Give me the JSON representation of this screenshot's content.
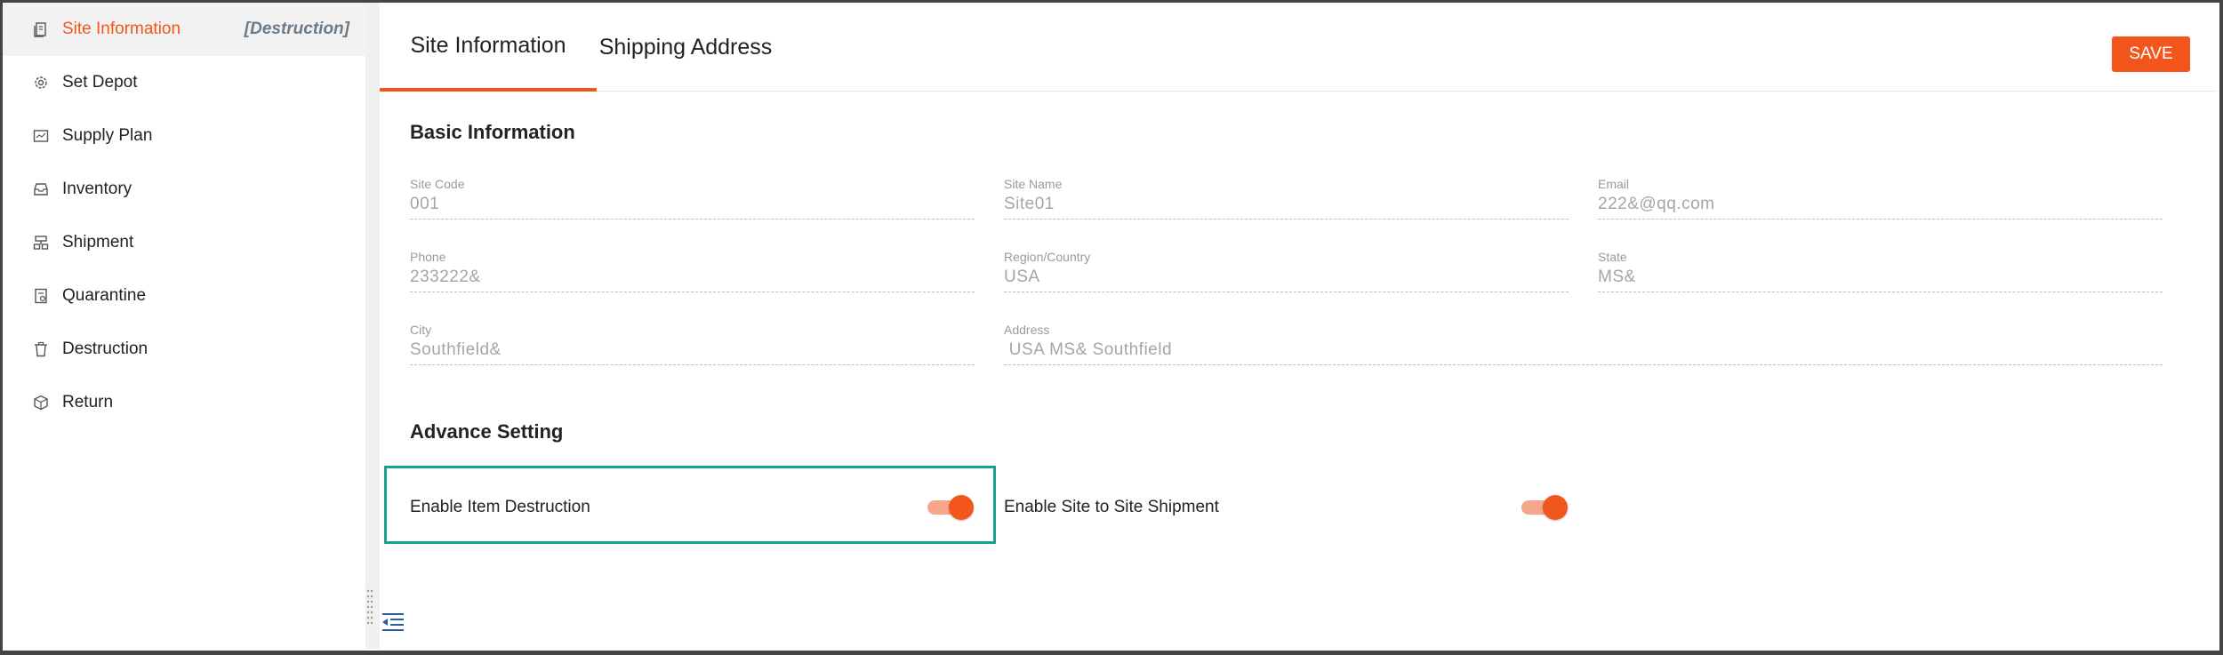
{
  "sidebar": {
    "items": [
      {
        "label": "Site Information",
        "tag": "[Destruction]",
        "icon": "document-icon",
        "active": true
      },
      {
        "label": "Set Depot",
        "icon": "gear-icon"
      },
      {
        "label": "Supply Plan",
        "icon": "calendar-icon"
      },
      {
        "label": "Inventory",
        "icon": "inbox-icon"
      },
      {
        "label": "Shipment",
        "icon": "shipment-icon"
      },
      {
        "label": "Quarantine",
        "icon": "quarantine-icon"
      },
      {
        "label": "Destruction",
        "icon": "trash-icon"
      },
      {
        "label": "Return",
        "icon": "box-icon"
      }
    ]
  },
  "tabs": [
    {
      "label": "Site Information",
      "active": true
    },
    {
      "label": "Shipping Address",
      "active": false
    }
  ],
  "toolbar": {
    "save_label": "SAVE"
  },
  "basic": {
    "title": "Basic Information",
    "fields": [
      {
        "label": "Site Code",
        "value": "001"
      },
      {
        "label": "Site Name",
        "value": "Site01"
      },
      {
        "label": "Email",
        "value": "222&@qq.com"
      },
      {
        "label": "Phone",
        "value": "233222&"
      },
      {
        "label": "Region/Country",
        "value": "USA"
      },
      {
        "label": "State",
        "value": "MS&"
      },
      {
        "label": "City",
        "value": "Southfield&"
      },
      {
        "label": "Address",
        "value": " USA MS& Southfield"
      }
    ]
  },
  "advance": {
    "title": "Advance Setting",
    "toggles": [
      {
        "label": "Enable Item Destruction",
        "on": true
      },
      {
        "label": "Enable Site to Site Shipment",
        "on": true
      }
    ]
  },
  "colors": {
    "accent": "#f2561d",
    "highlight": "#1aa291"
  }
}
